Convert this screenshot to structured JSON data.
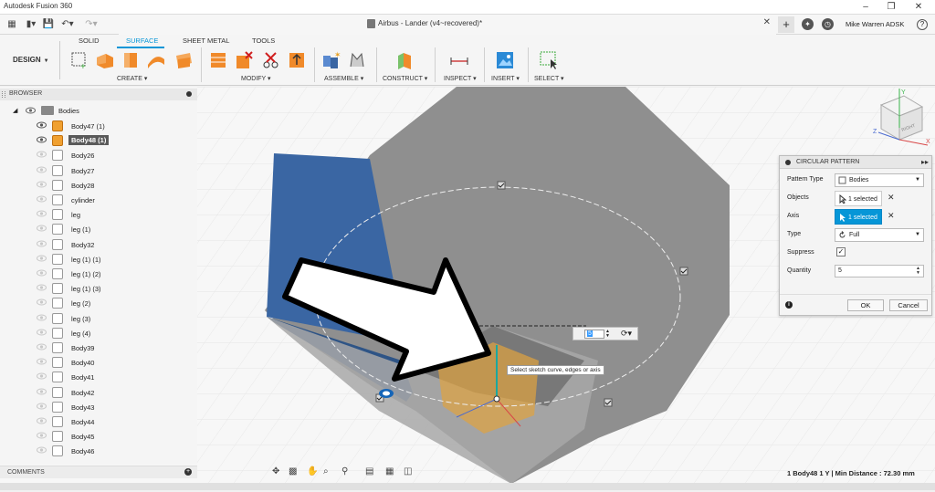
{
  "window": {
    "app_title": "Autodesk Fusion 360",
    "doc_title": "Airbus - Lander (v4~recovered)*",
    "user_name": "Mike Warren ADSK"
  },
  "toolbar": {
    "workspace": "DESIGN",
    "tabs": [
      "SOLID",
      "SURFACE",
      "SHEET METAL",
      "TOOLS"
    ],
    "active_tab": "SURFACE",
    "groups": [
      "CREATE",
      "MODIFY",
      "ASSEMBLE",
      "CONSTRUCT",
      "INSPECT",
      "INSERT",
      "SELECT"
    ],
    "accent": "#0696d7"
  },
  "browser": {
    "header": "BROWSER",
    "folder": "Bodies",
    "items": [
      {
        "label": "Body47 (1)",
        "visible": true,
        "orange": true
      },
      {
        "label": "Body48 (1)",
        "visible": true,
        "orange": true,
        "selected": true
      },
      {
        "label": "Body26"
      },
      {
        "label": "Body27"
      },
      {
        "label": "Body28"
      },
      {
        "label": "cylinder"
      },
      {
        "label": "leg"
      },
      {
        "label": "leg (1)"
      },
      {
        "label": "Body32"
      },
      {
        "label": "leg (1) (1)"
      },
      {
        "label": "leg (1) (2)"
      },
      {
        "label": "leg (1) (3)"
      },
      {
        "label": "leg (2)"
      },
      {
        "label": "leg (3)"
      },
      {
        "label": "leg (4)"
      },
      {
        "label": "Body39"
      },
      {
        "label": "Body40"
      },
      {
        "label": "Body41"
      },
      {
        "label": "Body42"
      },
      {
        "label": "Body43"
      },
      {
        "label": "Body44"
      },
      {
        "label": "Body45"
      },
      {
        "label": "Body46"
      }
    ],
    "comments": "COMMENTS"
  },
  "viewcube": {
    "face_label": "RIGHT",
    "axis_x": "X",
    "axis_y": "Y",
    "axis_z": "Z"
  },
  "dialog": {
    "title": "CIRCULAR PATTERN",
    "pattern_type_label": "Pattern Type",
    "pattern_type_value": "Bodies",
    "objects_label": "Objects",
    "objects_value": "1 selected",
    "axis_label": "Axis",
    "axis_value": "1 selected",
    "type_label": "Type",
    "type_value": "Full",
    "suppress_label": "Suppress",
    "suppress_checked": true,
    "quantity_label": "Quantity",
    "quantity_value": "5",
    "ok_label": "OK",
    "cancel_label": "Cancel"
  },
  "canvas": {
    "quantity_field": "5",
    "tooltip": "Select sketch curve, edges or axis"
  },
  "status": {
    "text": "1 Body48 1 Y | Min Distance : 72.30 mm"
  }
}
